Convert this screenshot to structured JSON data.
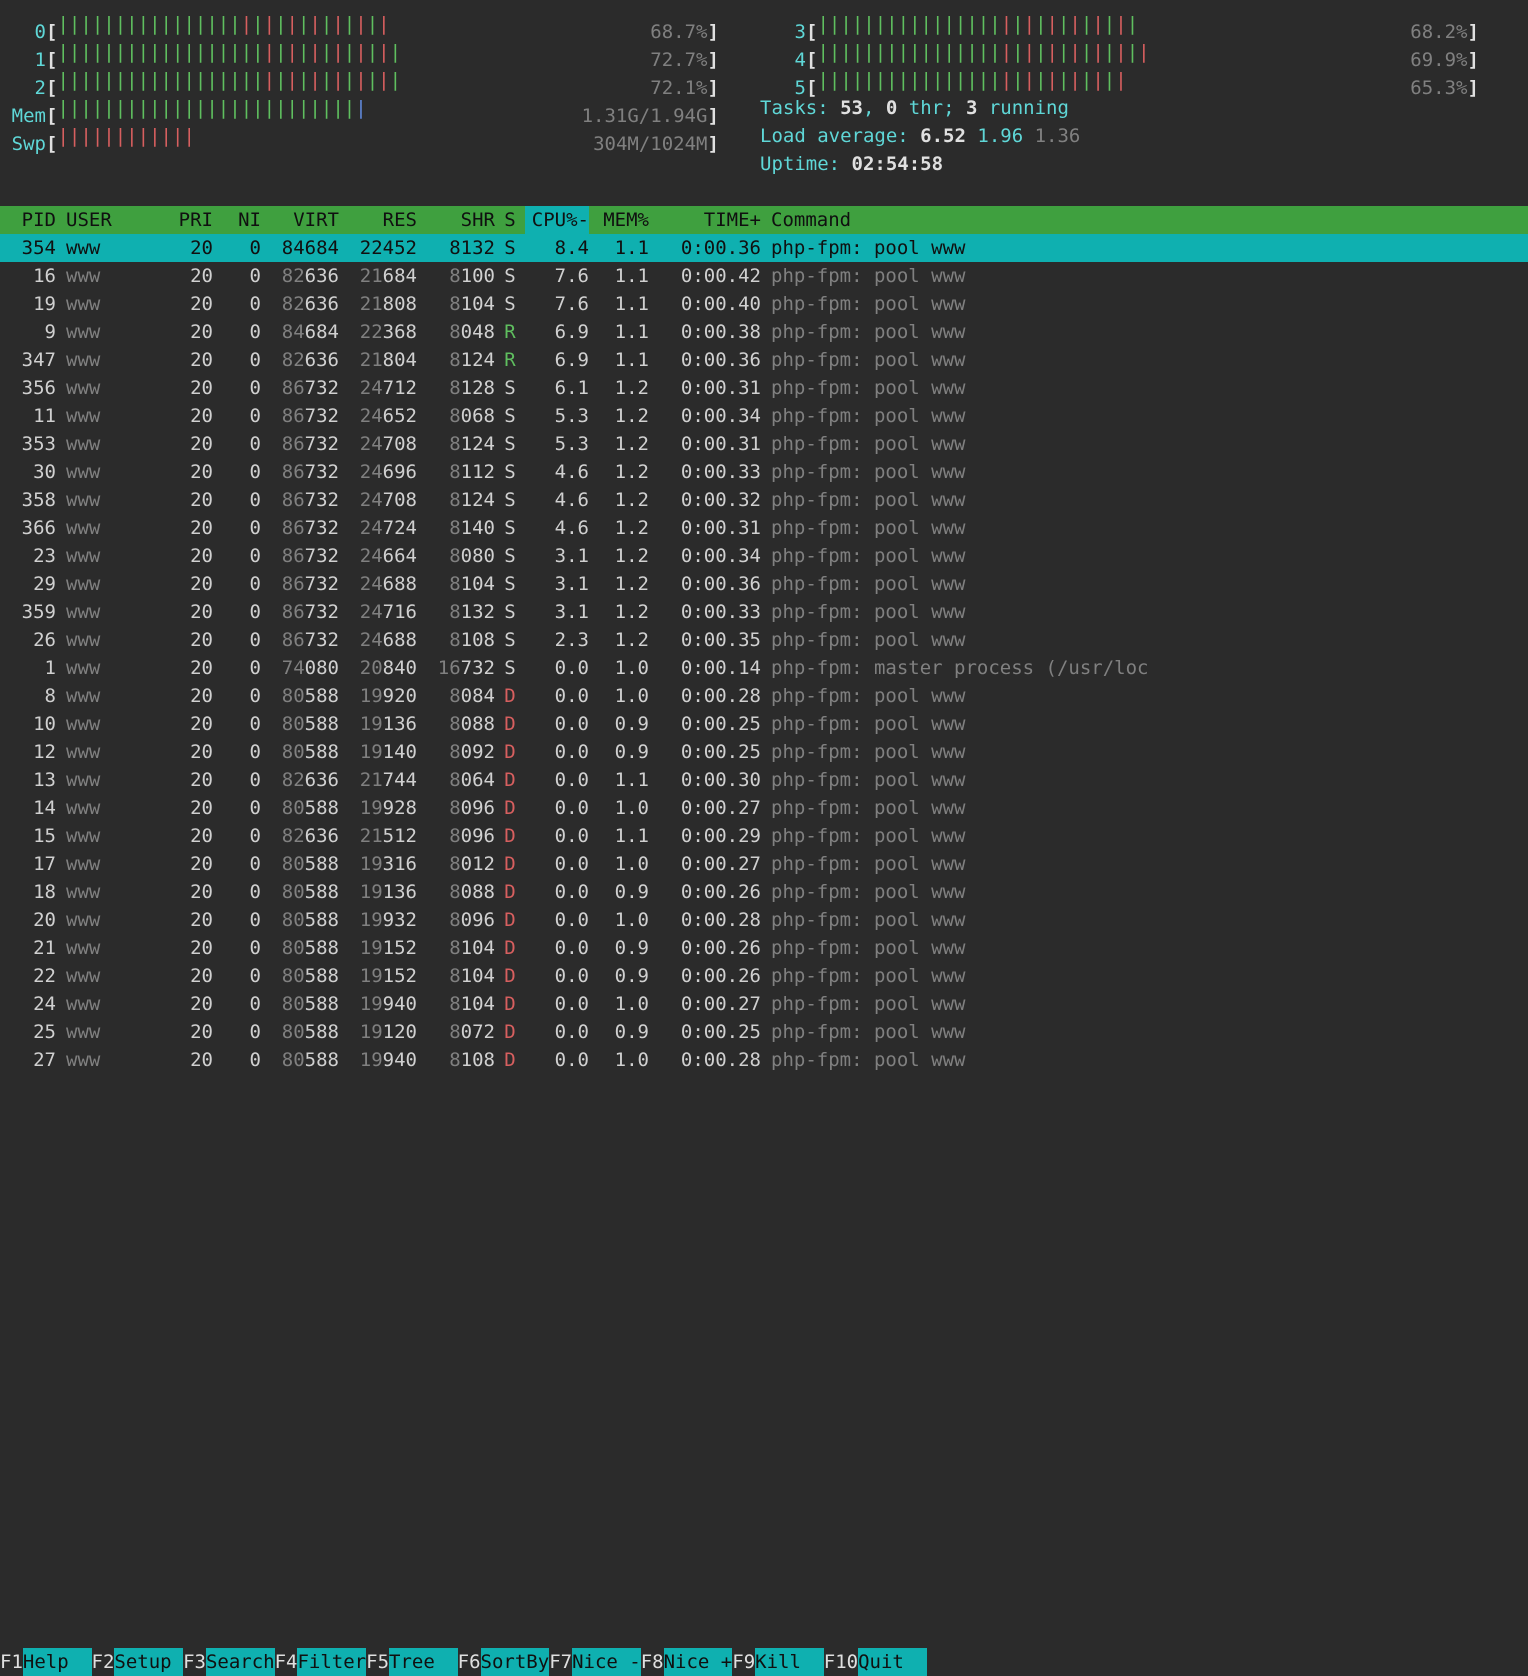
{
  "cpus": [
    {
      "id": "0",
      "pct": "68.7%",
      "bars": "|||||||||||||||||||||||||||||"
    },
    {
      "id": "1",
      "pct": "72.7%",
      "bars": "||||||||||||||||||||||||||||||"
    },
    {
      "id": "2",
      "pct": "72.1%",
      "bars": "||||||||||||||||||||||||||||||"
    },
    {
      "id": "3",
      "pct": "68.2%",
      "bars": "||||||||||||||||||||||||||||"
    },
    {
      "id": "4",
      "pct": "69.9%",
      "bars": "|||||||||||||||||||||||||||||"
    },
    {
      "id": "5",
      "pct": "65.3%",
      "bars": "|||||||||||||||||||||||||||"
    }
  ],
  "mem": {
    "label": "Mem",
    "bars": "|||||||||||||||||||||||||||",
    "used": "1.31G",
    "total": "1.94G"
  },
  "swp": {
    "label": "Swp",
    "bars": "||||||||||||",
    "used": "304M",
    "total": "1024M"
  },
  "tasks": {
    "label": "Tasks: ",
    "total": "53",
    "thr": "0",
    "thr_label": " thr; ",
    "running": "3",
    "running_label": " running"
  },
  "load": {
    "label": "Load average: ",
    "v1": "6.52",
    "v2": "1.96",
    "v3": "1.36"
  },
  "uptime": {
    "label": "Uptime: ",
    "value": "02:54:58"
  },
  "columns": {
    "pid": " PID",
    "user": "USER",
    "pri": "PRI",
    "ni": "NI",
    "virt": "VIRT",
    "res": "RES",
    "shr": "SHR",
    "s": "S",
    "cpu": "CPU%-",
    "mem": "MEM%",
    "time": "TIME+",
    "cmd": "Command"
  },
  "processes": [
    {
      "pid": "354",
      "user": "www",
      "pri": "20",
      "ni": "0",
      "virt": "84684",
      "res": "22452",
      "shr": "8132",
      "s": "S",
      "cpu": "8.4",
      "mem": "1.1",
      "time": "0:00.36",
      "cmd": "php-fpm: pool www",
      "sel": true
    },
    {
      "pid": "16",
      "user": "www",
      "pri": "20",
      "ni": "0",
      "virt": "82636",
      "res": "21684",
      "shr": "8100",
      "s": "S",
      "cpu": "7.6",
      "mem": "1.1",
      "time": "0:00.42",
      "cmd": "php-fpm: pool www"
    },
    {
      "pid": "19",
      "user": "www",
      "pri": "20",
      "ni": "0",
      "virt": "82636",
      "res": "21808",
      "shr": "8104",
      "s": "S",
      "cpu": "7.6",
      "mem": "1.1",
      "time": "0:00.40",
      "cmd": "php-fpm: pool www"
    },
    {
      "pid": "9",
      "user": "www",
      "pri": "20",
      "ni": "0",
      "virt": "84684",
      "res": "22368",
      "shr": "8048",
      "s": "R",
      "cpu": "6.9",
      "mem": "1.1",
      "time": "0:00.38",
      "cmd": "php-fpm: pool www"
    },
    {
      "pid": "347",
      "user": "www",
      "pri": "20",
      "ni": "0",
      "virt": "82636",
      "res": "21804",
      "shr": "8124",
      "s": "R",
      "cpu": "6.9",
      "mem": "1.1",
      "time": "0:00.36",
      "cmd": "php-fpm: pool www"
    },
    {
      "pid": "356",
      "user": "www",
      "pri": "20",
      "ni": "0",
      "virt": "86732",
      "res": "24712",
      "shr": "8128",
      "s": "S",
      "cpu": "6.1",
      "mem": "1.2",
      "time": "0:00.31",
      "cmd": "php-fpm: pool www"
    },
    {
      "pid": "11",
      "user": "www",
      "pri": "20",
      "ni": "0",
      "virt": "86732",
      "res": "24652",
      "shr": "8068",
      "s": "S",
      "cpu": "5.3",
      "mem": "1.2",
      "time": "0:00.34",
      "cmd": "php-fpm: pool www"
    },
    {
      "pid": "353",
      "user": "www",
      "pri": "20",
      "ni": "0",
      "virt": "86732",
      "res": "24708",
      "shr": "8124",
      "s": "S",
      "cpu": "5.3",
      "mem": "1.2",
      "time": "0:00.31",
      "cmd": "php-fpm: pool www"
    },
    {
      "pid": "30",
      "user": "www",
      "pri": "20",
      "ni": "0",
      "virt": "86732",
      "res": "24696",
      "shr": "8112",
      "s": "S",
      "cpu": "4.6",
      "mem": "1.2",
      "time": "0:00.33",
      "cmd": "php-fpm: pool www"
    },
    {
      "pid": "358",
      "user": "www",
      "pri": "20",
      "ni": "0",
      "virt": "86732",
      "res": "24708",
      "shr": "8124",
      "s": "S",
      "cpu": "4.6",
      "mem": "1.2",
      "time": "0:00.32",
      "cmd": "php-fpm: pool www"
    },
    {
      "pid": "366",
      "user": "www",
      "pri": "20",
      "ni": "0",
      "virt": "86732",
      "res": "24724",
      "shr": "8140",
      "s": "S",
      "cpu": "4.6",
      "mem": "1.2",
      "time": "0:00.31",
      "cmd": "php-fpm: pool www"
    },
    {
      "pid": "23",
      "user": "www",
      "pri": "20",
      "ni": "0",
      "virt": "86732",
      "res": "24664",
      "shr": "8080",
      "s": "S",
      "cpu": "3.1",
      "mem": "1.2",
      "time": "0:00.34",
      "cmd": "php-fpm: pool www"
    },
    {
      "pid": "29",
      "user": "www",
      "pri": "20",
      "ni": "0",
      "virt": "86732",
      "res": "24688",
      "shr": "8104",
      "s": "S",
      "cpu": "3.1",
      "mem": "1.2",
      "time": "0:00.36",
      "cmd": "php-fpm: pool www"
    },
    {
      "pid": "359",
      "user": "www",
      "pri": "20",
      "ni": "0",
      "virt": "86732",
      "res": "24716",
      "shr": "8132",
      "s": "S",
      "cpu": "3.1",
      "mem": "1.2",
      "time": "0:00.33",
      "cmd": "php-fpm: pool www"
    },
    {
      "pid": "26",
      "user": "www",
      "pri": "20",
      "ni": "0",
      "virt": "86732",
      "res": "24688",
      "shr": "8108",
      "s": "S",
      "cpu": "2.3",
      "mem": "1.2",
      "time": "0:00.35",
      "cmd": "php-fpm: pool www"
    },
    {
      "pid": "1",
      "user": "www",
      "pri": "20",
      "ni": "0",
      "virt": "74080",
      "res": "20840",
      "shr": "16732",
      "s": "S",
      "cpu": "0.0",
      "mem": "1.0",
      "time": "0:00.14",
      "cmd": "php-fpm: master process (/usr/loc"
    },
    {
      "pid": "8",
      "user": "www",
      "pri": "20",
      "ni": "0",
      "virt": "80588",
      "res": "19920",
      "shr": "8084",
      "s": "D",
      "cpu": "0.0",
      "mem": "1.0",
      "time": "0:00.28",
      "cmd": "php-fpm: pool www"
    },
    {
      "pid": "10",
      "user": "www",
      "pri": "20",
      "ni": "0",
      "virt": "80588",
      "res": "19136",
      "shr": "8088",
      "s": "D",
      "cpu": "0.0",
      "mem": "0.9",
      "time": "0:00.25",
      "cmd": "php-fpm: pool www"
    },
    {
      "pid": "12",
      "user": "www",
      "pri": "20",
      "ni": "0",
      "virt": "80588",
      "res": "19140",
      "shr": "8092",
      "s": "D",
      "cpu": "0.0",
      "mem": "0.9",
      "time": "0:00.25",
      "cmd": "php-fpm: pool www"
    },
    {
      "pid": "13",
      "user": "www",
      "pri": "20",
      "ni": "0",
      "virt": "82636",
      "res": "21744",
      "shr": "8064",
      "s": "D",
      "cpu": "0.0",
      "mem": "1.1",
      "time": "0:00.30",
      "cmd": "php-fpm: pool www"
    },
    {
      "pid": "14",
      "user": "www",
      "pri": "20",
      "ni": "0",
      "virt": "80588",
      "res": "19928",
      "shr": "8096",
      "s": "D",
      "cpu": "0.0",
      "mem": "1.0",
      "time": "0:00.27",
      "cmd": "php-fpm: pool www"
    },
    {
      "pid": "15",
      "user": "www",
      "pri": "20",
      "ni": "0",
      "virt": "82636",
      "res": "21512",
      "shr": "8096",
      "s": "D",
      "cpu": "0.0",
      "mem": "1.1",
      "time": "0:00.29",
      "cmd": "php-fpm: pool www"
    },
    {
      "pid": "17",
      "user": "www",
      "pri": "20",
      "ni": "0",
      "virt": "80588",
      "res": "19316",
      "shr": "8012",
      "s": "D",
      "cpu": "0.0",
      "mem": "1.0",
      "time": "0:00.27",
      "cmd": "php-fpm: pool www"
    },
    {
      "pid": "18",
      "user": "www",
      "pri": "20",
      "ni": "0",
      "virt": "80588",
      "res": "19136",
      "shr": "8088",
      "s": "D",
      "cpu": "0.0",
      "mem": "0.9",
      "time": "0:00.26",
      "cmd": "php-fpm: pool www"
    },
    {
      "pid": "20",
      "user": "www",
      "pri": "20",
      "ni": "0",
      "virt": "80588",
      "res": "19932",
      "shr": "8096",
      "s": "D",
      "cpu": "0.0",
      "mem": "1.0",
      "time": "0:00.28",
      "cmd": "php-fpm: pool www"
    },
    {
      "pid": "21",
      "user": "www",
      "pri": "20",
      "ni": "0",
      "virt": "80588",
      "res": "19152",
      "shr": "8104",
      "s": "D",
      "cpu": "0.0",
      "mem": "0.9",
      "time": "0:00.26",
      "cmd": "php-fpm: pool www"
    },
    {
      "pid": "22",
      "user": "www",
      "pri": "20",
      "ni": "0",
      "virt": "80588",
      "res": "19152",
      "shr": "8104",
      "s": "D",
      "cpu": "0.0",
      "mem": "0.9",
      "time": "0:00.26",
      "cmd": "php-fpm: pool www"
    },
    {
      "pid": "24",
      "user": "www",
      "pri": "20",
      "ni": "0",
      "virt": "80588",
      "res": "19940",
      "shr": "8104",
      "s": "D",
      "cpu": "0.0",
      "mem": "1.0",
      "time": "0:00.27",
      "cmd": "php-fpm: pool www"
    },
    {
      "pid": "25",
      "user": "www",
      "pri": "20",
      "ni": "0",
      "virt": "80588",
      "res": "19120",
      "shr": "8072",
      "s": "D",
      "cpu": "0.0",
      "mem": "0.9",
      "time": "0:00.25",
      "cmd": "php-fpm: pool www"
    },
    {
      "pid": "27",
      "user": "www",
      "pri": "20",
      "ni": "0",
      "virt": "80588",
      "res": "19940",
      "shr": "8108",
      "s": "D",
      "cpu": "0.0",
      "mem": "1.0",
      "time": "0:00.28",
      "cmd": "php-fpm: pool www"
    }
  ],
  "fkeys": [
    {
      "k": "F1",
      "l": "Help  "
    },
    {
      "k": "F2",
      "l": "Setup "
    },
    {
      "k": "F3",
      "l": "Search"
    },
    {
      "k": "F4",
      "l": "Filter"
    },
    {
      "k": "F5",
      "l": "Tree  "
    },
    {
      "k": "F6",
      "l": "SortBy"
    },
    {
      "k": "F7",
      "l": "Nice -"
    },
    {
      "k": "F8",
      "l": "Nice +"
    },
    {
      "k": "F9",
      "l": "Kill  "
    },
    {
      "k": "F10",
      "l": "Quit  "
    }
  ]
}
